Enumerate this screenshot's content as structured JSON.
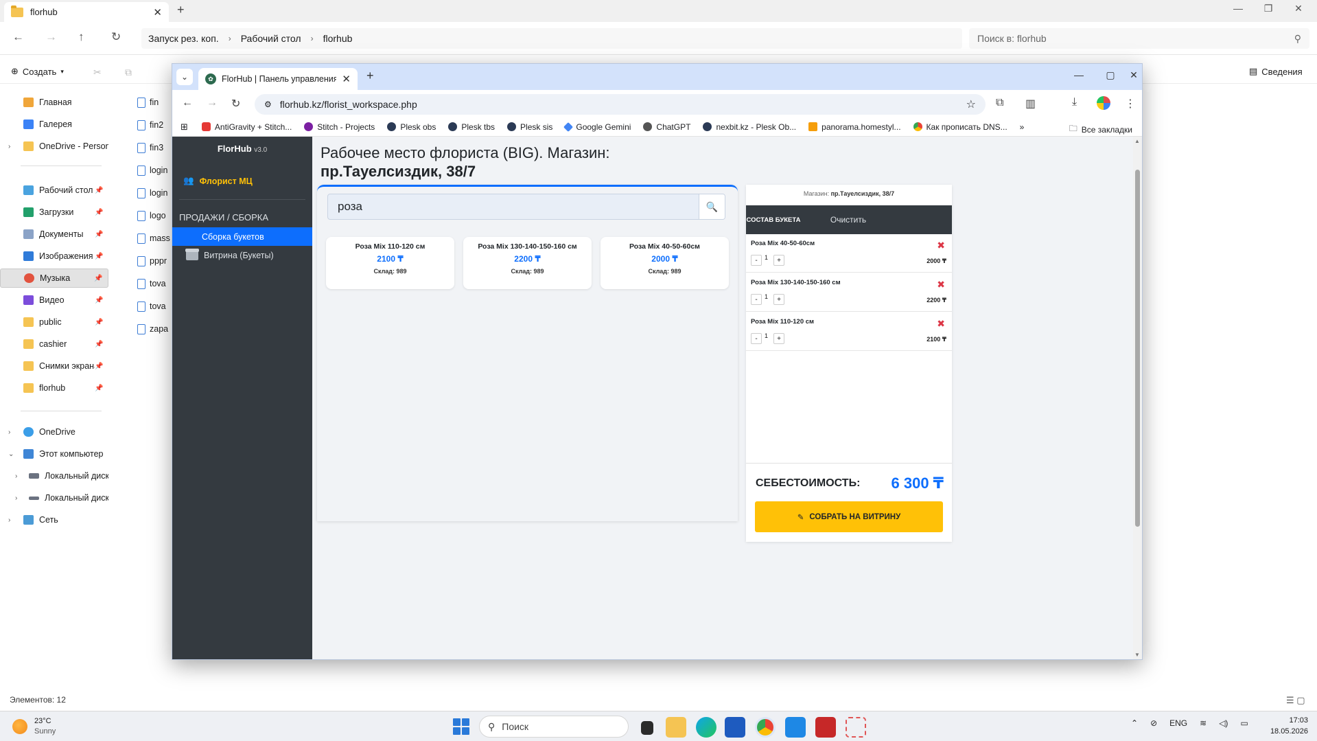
{
  "explorer": {
    "tab_title": "florhub",
    "breadcrumb": [
      "Запуск рез. коп.",
      "Рабочий стол",
      "florhub"
    ],
    "search_placeholder": "Поиск в: florhub",
    "create_label": "Создать",
    "details_label": "Сведения",
    "sidebar": {
      "quick": [
        {
          "label": "Главная"
        },
        {
          "label": "Галерея"
        },
        {
          "label": "OneDrive - Persona"
        }
      ],
      "pinned": [
        {
          "label": "Рабочий стол"
        },
        {
          "label": "Загрузки"
        },
        {
          "label": "Документы"
        },
        {
          "label": "Изображения"
        },
        {
          "label": "Музыка"
        },
        {
          "label": "Видео"
        },
        {
          "label": "public"
        },
        {
          "label": "cashier"
        },
        {
          "label": "Снимки экрана"
        },
        {
          "label": "florhub"
        }
      ],
      "tree": [
        {
          "label": "OneDrive"
        },
        {
          "label": "Этот компьютер"
        },
        {
          "label": "Локальный диск"
        },
        {
          "label": "Локальный диск"
        },
        {
          "label": "Сеть"
        }
      ]
    },
    "files": [
      "fin",
      "fin2",
      "fin3",
      "login",
      "login",
      "logo",
      "mass",
      "pppr",
      "tova",
      "tova",
      "zapa"
    ],
    "status": "Элементов: 12"
  },
  "taskbar": {
    "weather_temp": "23°C",
    "weather_desc": "Sunny",
    "search_placeholder": "Поиск",
    "lang": "ENG",
    "time": "17:03",
    "date": "18.05.2026"
  },
  "browser": {
    "tab_title": "FlorHub | Панель управления",
    "url": "florhub.kz/florist_workspace.php",
    "bookmarks": [
      {
        "label": "AntiGravity + Stitch...",
        "color": "#e53935"
      },
      {
        "label": "Stitch - Projects",
        "color": "#7b1fa2"
      },
      {
        "label": "Plesk obs",
        "color": "#2b3a55"
      },
      {
        "label": "Plesk tbs",
        "color": "#2b3a55"
      },
      {
        "label": "Plesk sis",
        "color": "#2b3a55"
      },
      {
        "label": "Google Gemini",
        "color": "#4285f4"
      },
      {
        "label": "ChatGPT",
        "color": "#555555"
      },
      {
        "label": "nexbit.kz - Plesk Ob...",
        "color": "#2b3a55"
      },
      {
        "label": "panorama.homestyl...",
        "color": "#f59e0b"
      },
      {
        "label": "Как прописать DNS...",
        "color": "#ea4335"
      }
    ],
    "all_bookmarks": "Все закладки"
  },
  "app": {
    "brand": "FlorHub",
    "version": "v3.0",
    "user_role": "Флорист МЦ",
    "section": "ПРОДАЖИ / СБОРКА",
    "nav": {
      "build": "Сборка букетов",
      "showcase": "Витрина (Букеты)"
    },
    "title_line1": "Рабочее место флориста (BIG). Магазин:",
    "title_store": "пр.Тауелсиздик, 38/7",
    "search_value": "роза",
    "products": [
      {
        "name": "Роза Mix 110-120 см",
        "price": "2100 ₸",
        "stock": "Склад: 989"
      },
      {
        "name": "Роза Mix 130-140-150-160 см",
        "price": "2200 ₸",
        "stock": "Склад: 989"
      },
      {
        "name": "Роза Mix 40-50-60см",
        "price": "2000 ₸",
        "stock": "Склад: 989"
      }
    ],
    "cart": {
      "store_label": "Магазин:",
      "store_name": "пр.Тауелсиздик, 38/7",
      "tab": "СОСТАВ БУКЕТА",
      "clear": "Очистить",
      "items": [
        {
          "name": "Роза Mix 40-50-60см",
          "qty": "1",
          "price": "2000 ₸"
        },
        {
          "name": "Роза Mix 130-140-150-160 см",
          "qty": "1",
          "price": "2200 ₸"
        },
        {
          "name": "Роза Mix 110-120 см",
          "qty": "1",
          "price": "2100 ₸"
        }
      ],
      "minus": "-",
      "plus": "+",
      "cost_label": "СЕБЕСТОИМОСТЬ:",
      "cost_value": "6 300 ₸",
      "build_button": "СОБРАТЬ НА ВИТРИНУ"
    }
  },
  "colors": {
    "primary": "#0d6efd",
    "sidebar_bg": "#343a40",
    "accent_yellow": "#ffc107",
    "danger": "#dc3545"
  }
}
